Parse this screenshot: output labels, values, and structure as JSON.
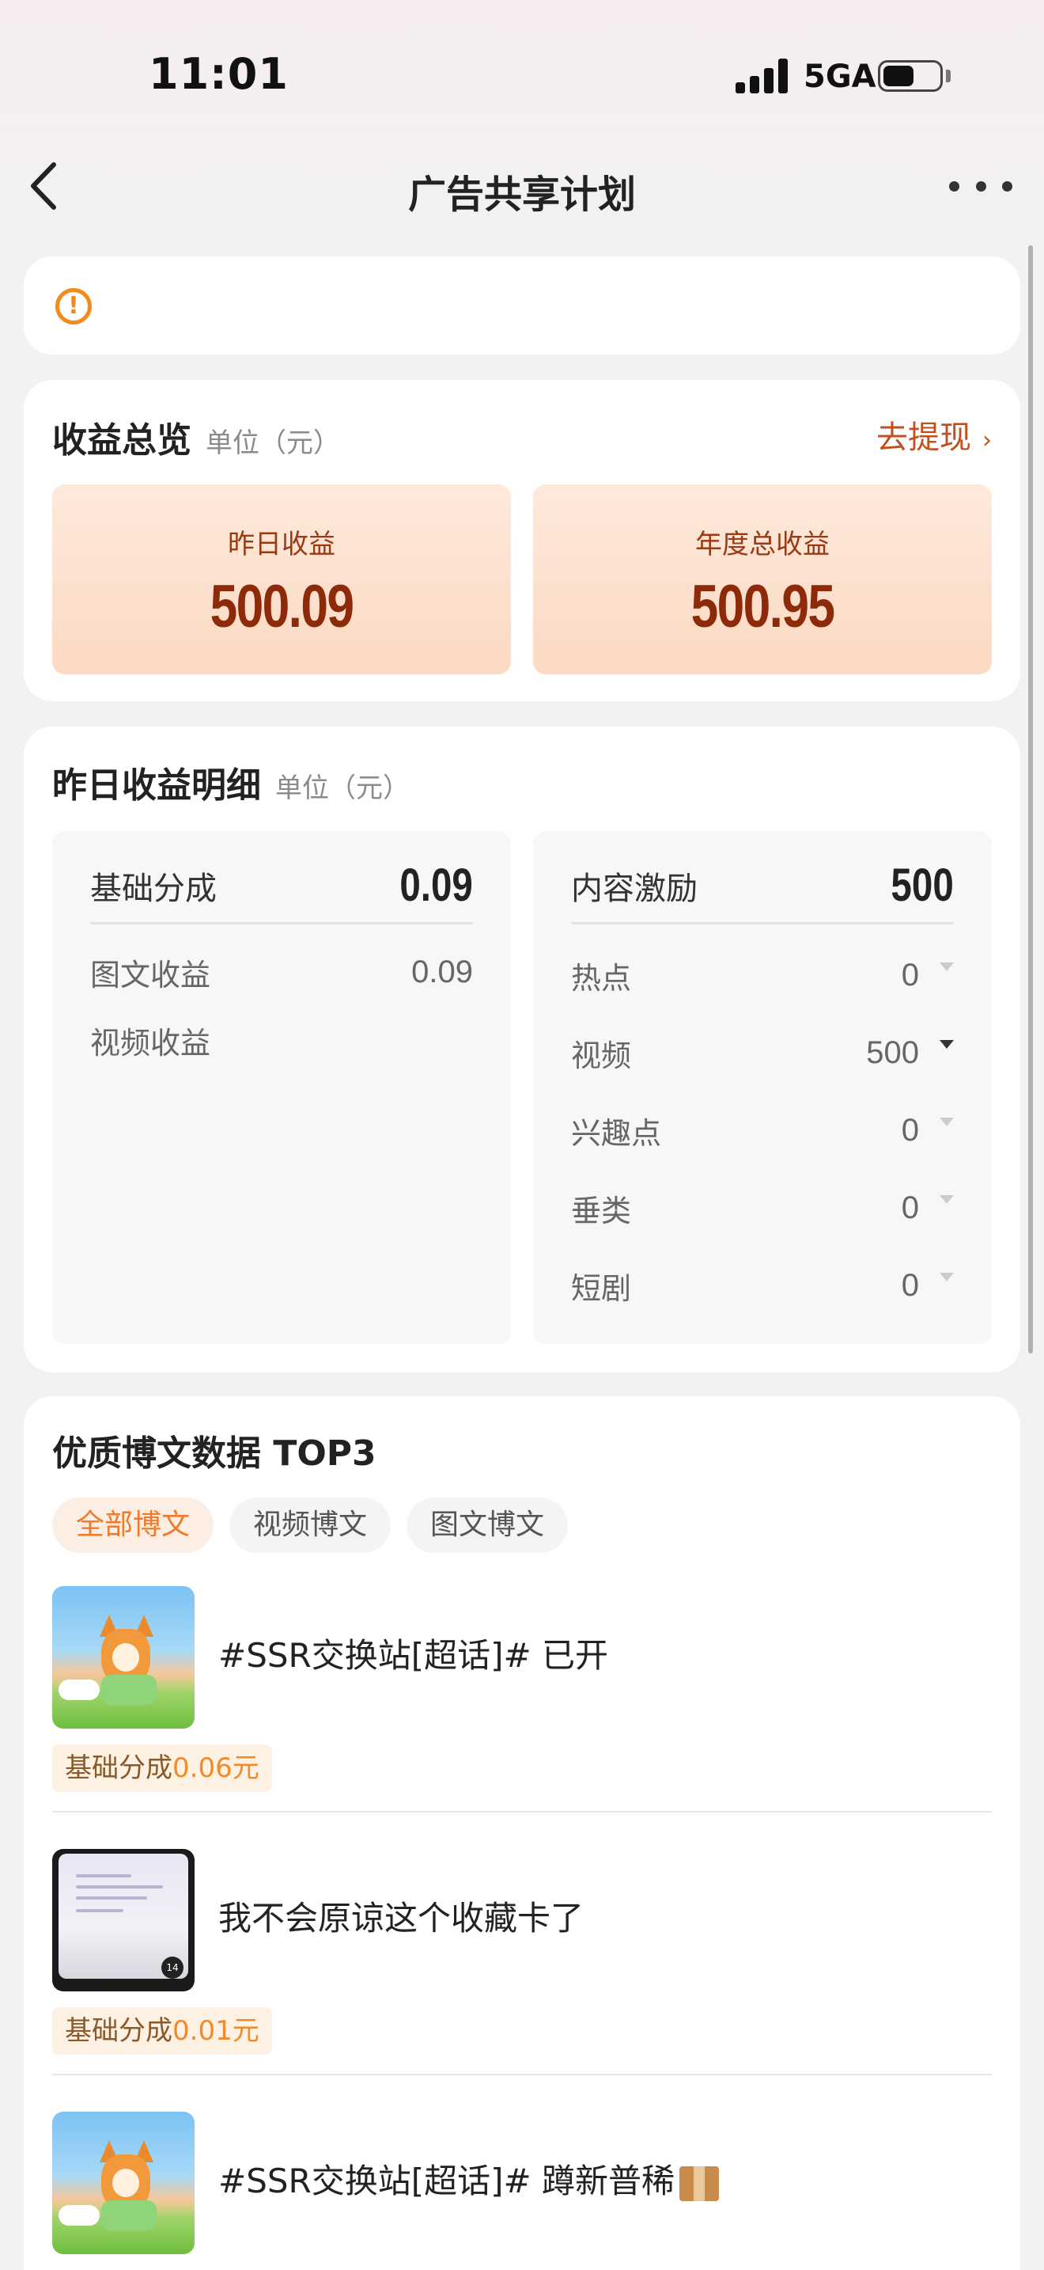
{
  "status_bar": {
    "time": "11:01",
    "network": "5GA"
  },
  "nav": {
    "title": "广告共享计划"
  },
  "notice": {
    "icon": "warning-circle-icon"
  },
  "overview": {
    "title": "收益总览",
    "unit": "单位（元）",
    "withdraw": "去提现",
    "yesterday_label": "昨日收益",
    "yesterday_value": "500.09",
    "annual_label": "年度总收益",
    "annual_value": "500.95"
  },
  "detail": {
    "title": "昨日收益明细",
    "unit": "单位（元）",
    "base": {
      "label": "基础分成",
      "value": "0.09",
      "rows": [
        {
          "label": "图文收益",
          "value": "0.09"
        },
        {
          "label": "视频收益",
          "value": ""
        }
      ]
    },
    "content": {
      "label": "内容激励",
      "value": "500",
      "rows": [
        {
          "label": "热点",
          "value": "0"
        },
        {
          "label": "视频",
          "value": "500"
        },
        {
          "label": "兴趣点",
          "value": "0"
        },
        {
          "label": "垂类",
          "value": "0"
        },
        {
          "label": "短剧",
          "value": "0"
        }
      ]
    }
  },
  "top3": {
    "title": "优质博文数据 TOP3",
    "tabs": [
      "全部博文",
      "视频博文",
      "图文博文"
    ],
    "active_tab": "全部博文",
    "posts": [
      {
        "title": "#SSR交换站[超话]# 已开",
        "reward_label": "基础分成",
        "reward_amount": "0.06元"
      },
      {
        "title": "我不会原谅这个收藏卡了",
        "reward_label": "基础分成",
        "reward_amount": "0.01元"
      },
      {
        "title": "#SSR交换站[超话]# 蹲新普稀",
        "reward_label": "",
        "reward_amount": ""
      }
    ]
  },
  "colors": {
    "accent": "#f07a2a",
    "earn_text": "#8c2a0a",
    "withdraw": "#c2501e"
  }
}
